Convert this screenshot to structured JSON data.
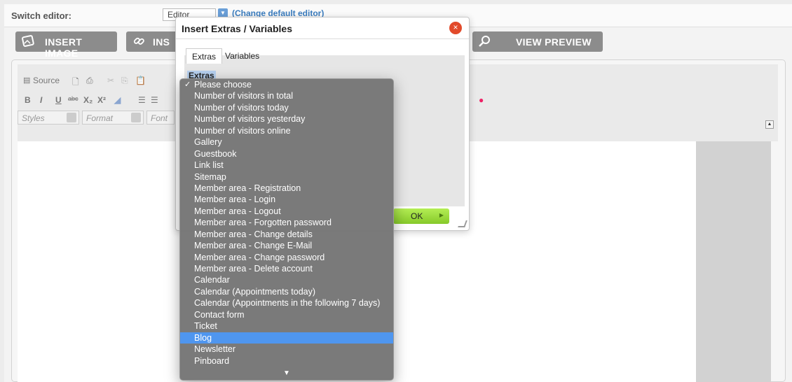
{
  "topbar": {
    "switch_label": "Switch editor:",
    "editor_value": "Editor",
    "change_link": "(Change default editor)"
  },
  "buttons": {
    "insert_image": "INSERT IMAGE",
    "insert_link": "INS",
    "view_preview": "VIEW PREVIEW"
  },
  "toolbar": {
    "source": "Source",
    "styles": "Styles",
    "format": "Format",
    "font": "Font"
  },
  "modal": {
    "title": "Insert Extras / Variables",
    "tabs": [
      "Extras",
      "Variables"
    ],
    "section_label": "Extras",
    "ok_label": "OK"
  },
  "dropdown": {
    "selected_index": 0,
    "highlight_index": 22,
    "items": [
      "Please choose",
      "Number of visitors in total",
      "Number of visitors today",
      "Number of visitors yesterday",
      "Number of visitors online",
      "Gallery",
      "Guestbook",
      "Link list",
      "Sitemap",
      "Member area - Registration",
      "Member area - Login",
      "Member area - Logout",
      "Member area - Forgotten password",
      "Member area - Change details",
      "Member area - Change E-Mail",
      "Member area - Change password",
      "Member area - Delete account",
      "Calendar",
      "Calendar (Appointments today)",
      "Calendar (Appointments in the following 7 days)",
      "Contact form",
      "Ticket",
      "Blog",
      "Newsletter",
      "Pinboard"
    ]
  },
  "colors": {
    "accent": "#4f96ef",
    "ok_button": "#9ad93a",
    "close_button": "#e24a2a",
    "button_gray": "#8c8c8c"
  }
}
